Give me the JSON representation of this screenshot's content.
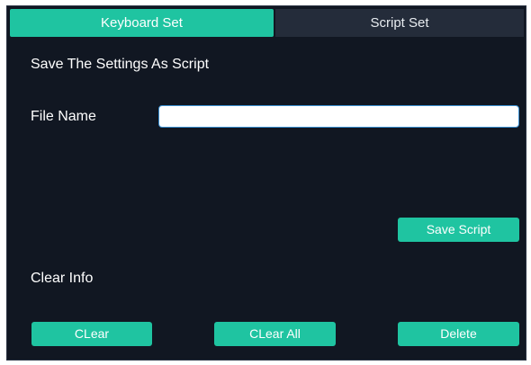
{
  "tabs": {
    "keyboard_set": "Keyboard Set",
    "script_set": "Script Set"
  },
  "save_section": {
    "heading": "Save The Settings As Script",
    "file_name_label": "File Name",
    "file_name_value": "",
    "save_button": "Save Script"
  },
  "clear_section": {
    "heading": "Clear Info",
    "clear_button": "CLear",
    "clear_all_button": "CLear All",
    "delete_button": "Delete"
  },
  "colors": {
    "accent": "#1fc4a1",
    "panel_background": "#111722",
    "inactive_tab": "#242c3a",
    "input_border": "#3a8fd0"
  }
}
